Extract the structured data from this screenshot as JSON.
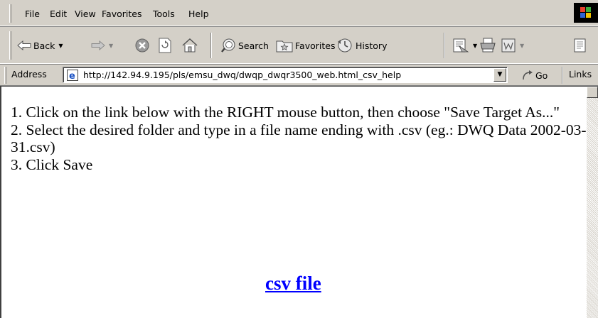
{
  "menu": {
    "items": [
      "File",
      "Edit",
      "View",
      "Favorites",
      "Tools",
      "Help"
    ]
  },
  "toolbar": {
    "back_label": "Back",
    "search_label": "Search",
    "favorites_label": "Favorites",
    "history_label": "History"
  },
  "address_bar": {
    "label": "Address",
    "url": "http://142.94.9.195/pls/emsu_dwq/dwqp_dwqr3500_web.html_csv_help",
    "go_label": "Go",
    "links_label": "Links"
  },
  "content": {
    "instructions": [
      "1. Click on the link below with the RIGHT mouse button, then choose \"Save Target As...\"",
      "2. Select the desired folder and type in a file name ending with .csv (eg.: DWQ Data 2002-03-31.csv)",
      "3. Click Save"
    ],
    "link_text": "csv file"
  },
  "colors": {
    "chrome": "#d4d0c8",
    "link": "#0000ff",
    "page_background": "#ffffff"
  }
}
